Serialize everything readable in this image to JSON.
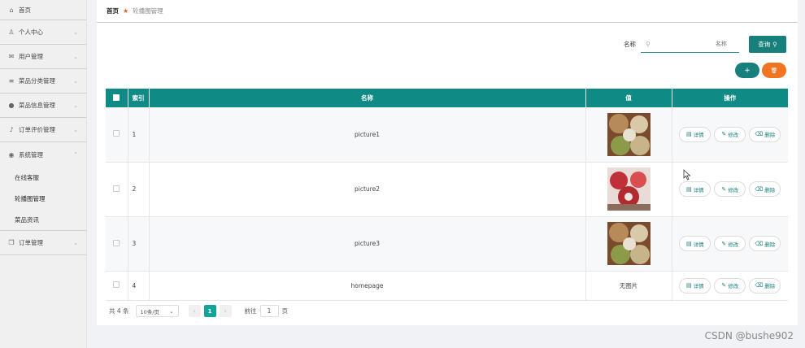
{
  "sidebar": {
    "home": "首页",
    "items": [
      {
        "label": "个人中心",
        "icon": "user-icon"
      },
      {
        "label": "用户管理",
        "icon": "mail-icon"
      },
      {
        "label": "菜品分类管理",
        "icon": "list-icon"
      },
      {
        "label": "菜品信息管理",
        "icon": "pin-icon"
      },
      {
        "label": "订单评价管理",
        "icon": "mic-icon"
      },
      {
        "label": "系统管理",
        "icon": "circle-icon"
      }
    ],
    "sub_items": [
      "在线客服",
      "轮播图管理",
      "菜品资讯"
    ],
    "last_item": {
      "label": "订单管理",
      "icon": "copy-icon"
    }
  },
  "breadcrumb": {
    "home": "首页",
    "current": "轮播图管理"
  },
  "search": {
    "label": "名称",
    "placeholder": "名称",
    "button": "查询"
  },
  "table": {
    "headers": [
      "索引",
      "名称",
      "值",
      "操作"
    ],
    "rows": [
      {
        "index": "1",
        "name": "picture1",
        "value": ""
      },
      {
        "index": "2",
        "name": "picture2",
        "value": ""
      },
      {
        "index": "3",
        "name": "picture3",
        "value": ""
      },
      {
        "index": "4",
        "name": "homepage",
        "value": "无图片"
      }
    ],
    "actions": {
      "detail": "详情",
      "edit": "修改",
      "delete": "删除"
    }
  },
  "pagination": {
    "total": "共 4 条",
    "page_size": "10条/页",
    "current": "1",
    "goto_label": "前往",
    "goto_value": "1",
    "page_unit": "页"
  },
  "watermark": "CSDN @bushe902",
  "colors": {
    "primary": "#177f7c",
    "header": "#0f8a84",
    "danger": "#f07422"
  }
}
